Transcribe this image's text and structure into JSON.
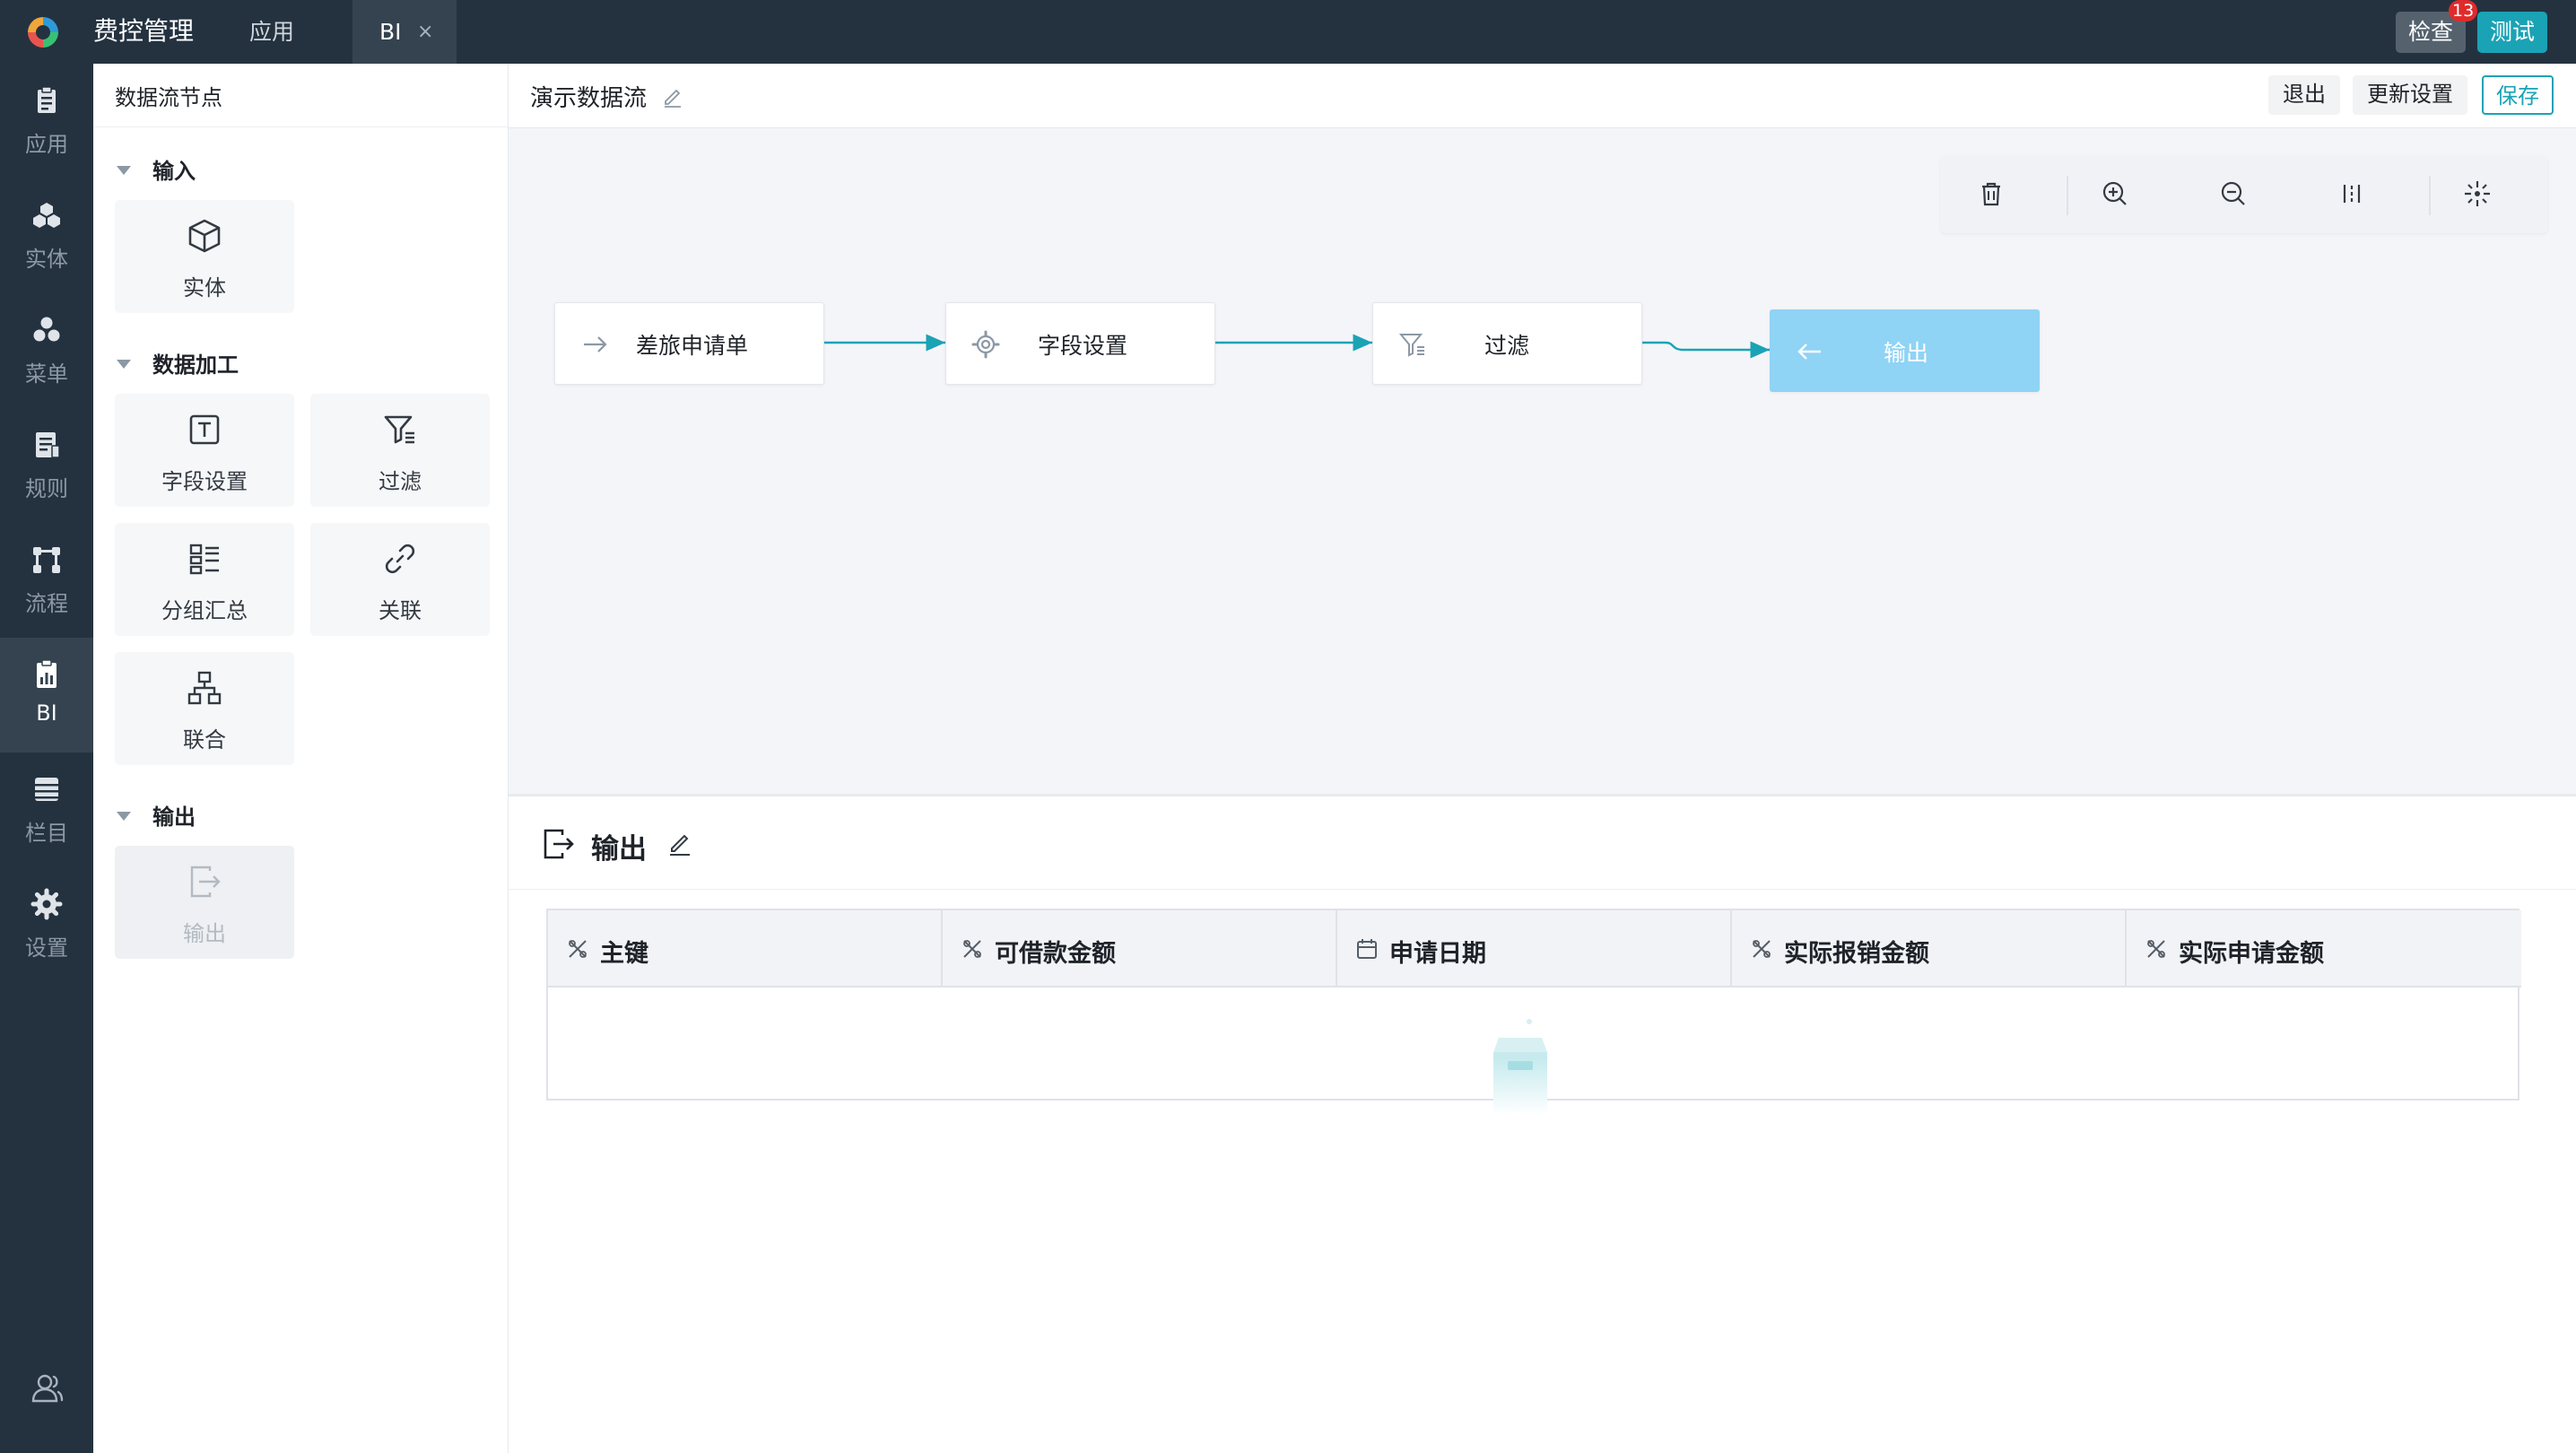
{
  "topbar": {
    "app_title": "费控管理",
    "tabs": [
      {
        "label": "应用"
      },
      {
        "label": "BI",
        "close": "×"
      }
    ],
    "check_button": "检查",
    "check_badge": "13",
    "test_button": "测试"
  },
  "rail": {
    "items": [
      {
        "label": "应用",
        "icon": "clipboard-icon"
      },
      {
        "label": "实体",
        "icon": "cubes-icon"
      },
      {
        "label": "菜单",
        "icon": "menu-dots-icon"
      },
      {
        "label": "规则",
        "icon": "rules-doc-icon"
      },
      {
        "label": "流程",
        "icon": "process-icon"
      },
      {
        "label": "BI",
        "icon": "bi-report-icon"
      },
      {
        "label": "栏目",
        "icon": "column-list-icon"
      },
      {
        "label": "设置",
        "icon": "gear-icon"
      }
    ],
    "active_item": "BI"
  },
  "palette": {
    "title": "数据流节点",
    "groups": [
      {
        "title": "输入",
        "nodes": [
          {
            "label": "实体"
          }
        ]
      },
      {
        "title": "数据加工",
        "nodes": [
          {
            "label": "字段设置"
          },
          {
            "label": "过滤"
          },
          {
            "label": "分组汇总"
          },
          {
            "label": "关联"
          },
          {
            "label": "联合"
          }
        ]
      },
      {
        "title": "输出",
        "nodes": [
          {
            "label": "输出"
          }
        ]
      }
    ]
  },
  "editor": {
    "flow_name": "演示数据流",
    "exit_button": "退出",
    "update_button": "更新设置",
    "save_button": "保存"
  },
  "canvas": {
    "nodes": [
      {
        "label": "差旅申请单",
        "icon": "arrow-right-icon"
      },
      {
        "label": "字段设置",
        "icon": "gear-outline-icon"
      },
      {
        "label": "过滤",
        "icon": "filter-icon"
      },
      {
        "label": "输出",
        "icon": "arrow-left-icon"
      }
    ],
    "toolbar": [
      "delete-icon",
      "zoom-in-icon",
      "zoom-out-icon",
      "fit-width-icon",
      "center-icon"
    ],
    "link_color": "#1aa3b5"
  },
  "output_panel": {
    "title": "输出",
    "columns": [
      {
        "label": "主键",
        "icon": "number-type-icon"
      },
      {
        "label": "可借款金额",
        "icon": "number-type-icon"
      },
      {
        "label": "申请日期",
        "icon": "calendar-icon"
      },
      {
        "label": "实际报销金额",
        "icon": "number-type-icon"
      },
      {
        "label": "实际申请金额",
        "icon": "number-type-icon"
      }
    ]
  },
  "colors": {
    "topbar_bg": "#243240",
    "accent": "#1aa3b5",
    "canvas_bg": "#f4f5f9",
    "output_node": "#8fd3f5"
  }
}
